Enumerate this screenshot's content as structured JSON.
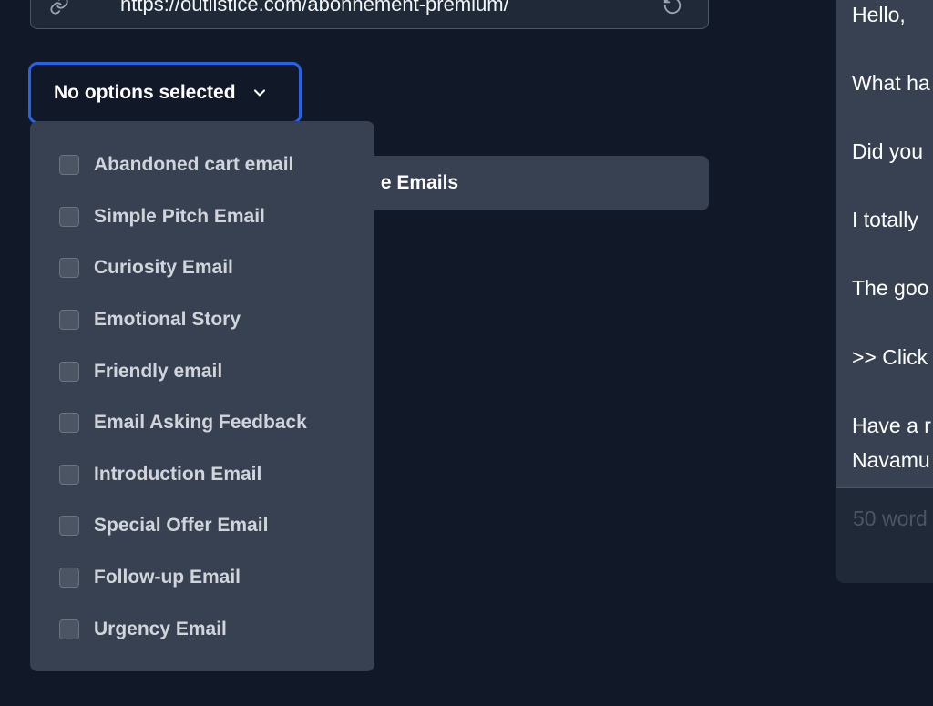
{
  "url_input": {
    "value": "https://outilstice.com/abonnement-premium/"
  },
  "multiselect": {
    "label": "No options selected",
    "options": [
      "Abandoned cart email",
      "Simple Pitch Email",
      "Curiosity Email",
      "Emotional Story",
      "Friendly email",
      "Email Asking Feedback",
      "Introduction Email",
      "Special Offer Email",
      "Follow-up Email",
      "Urgency Email"
    ]
  },
  "generate_button": {
    "label": "e Emails"
  },
  "preview": {
    "lines": [
      "Hello,",
      "What ha",
      "Did you",
      "I totally",
      "The goo",
      ">> Click",
      "Have a r",
      "Navamu"
    ],
    "word_count": "50 word"
  },
  "colors": {
    "background": "#111827",
    "panel": "#374151",
    "accent_focus": "#2563eb"
  },
  "icons": {
    "url_leading": "link-icon",
    "url_trailing": "refresh-icon",
    "toggle": "chevron-down-icon"
  }
}
